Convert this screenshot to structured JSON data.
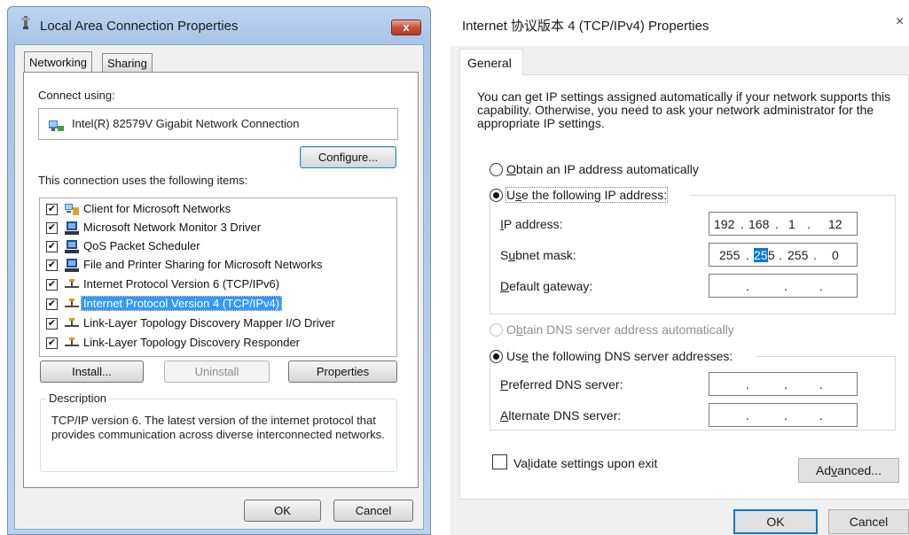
{
  "left_dialog": {
    "title": "Local Area Connection Properties",
    "close_label": "x",
    "tabs": [
      {
        "label": "Networking",
        "active": true
      },
      {
        "label": "Sharing",
        "active": false
      }
    ],
    "connect_using_label": "Connect using:",
    "adapter_name": "Intel(R) 82579V Gigabit Network Connection",
    "configure_label": "Configure...",
    "items_label": "This connection uses the following items:",
    "items": [
      {
        "label": "Client for Microsoft Networks",
        "checked": true,
        "icon": "network-client-icon"
      },
      {
        "label": "Microsoft Network Monitor 3 Driver",
        "checked": true,
        "icon": "network-service-icon"
      },
      {
        "label": "QoS Packet Scheduler",
        "checked": true,
        "icon": "network-service-icon"
      },
      {
        "label": "File and Printer Sharing for Microsoft Networks",
        "checked": true,
        "icon": "network-service-icon"
      },
      {
        "label": "Internet Protocol Version 6 (TCP/IPv6)",
        "checked": true,
        "icon": "protocol-icon"
      },
      {
        "label": "Internet Protocol Version 4 (TCP/IPv4)",
        "checked": true,
        "icon": "protocol-icon",
        "selected": true
      },
      {
        "label": "Link-Layer Topology Discovery Mapper I/O Driver",
        "checked": true,
        "icon": "protocol-icon"
      },
      {
        "label": "Link-Layer Topology Discovery Responder",
        "checked": true,
        "icon": "protocol-icon"
      }
    ],
    "install_label": "Install...",
    "uninstall_label": "Uninstall",
    "properties_label": "Properties",
    "description_legend": "Description",
    "description_text": "TCP/IP version 6. The latest version of the internet protocol that provides communication across diverse interconnected networks.",
    "ok_label": "OK",
    "cancel_label": "Cancel"
  },
  "right_dialog": {
    "title": "Internet 协议版本 4 (TCP/IPv4) Properties",
    "close_label": "×",
    "tab_label": "General",
    "intro_text": "You can get IP settings assigned automatically if your network supports this capability. Otherwise, you need to ask your network administrator for the appropriate IP settings.",
    "ip_auto": {
      "pre": "",
      "key": "O",
      "post": "btain an IP address automatically",
      "selected": false
    },
    "ip_manual": {
      "pre": "U",
      "key": "s",
      "post": "e the following IP address:",
      "selected": true
    },
    "ip_address": {
      "label_key": "I",
      "label_post": "P address:",
      "octets": [
        "192",
        "168",
        "1",
        "12"
      ]
    },
    "subnet_mask": {
      "label_pre": "S",
      "label_key": "u",
      "label_post": "bnet mask:",
      "octets": [
        "255",
        "255",
        "255",
        "0"
      ],
      "highlight": "25"
    },
    "default_gateway": {
      "label_key": "D",
      "label_post": "efault gateway:",
      "octets": [
        "",
        "",
        "",
        ""
      ]
    },
    "dns_auto": {
      "pre": "O",
      "key": "b",
      "post": "tain DNS server address automatically",
      "selected": false,
      "disabled": true
    },
    "dns_manual": {
      "pre": "Us",
      "key": "e",
      "post": " the following DNS server addresses:",
      "selected": true
    },
    "preferred_dns": {
      "label_key": "P",
      "label_post": "referred DNS server:",
      "octets": [
        "",
        "",
        "",
        ""
      ]
    },
    "alternate_dns": {
      "label_key": "A",
      "label_post": "lternate DNS server:",
      "octets": [
        "",
        "",
        "",
        ""
      ]
    },
    "validate": {
      "pre": "Va",
      "key": "l",
      "post": "idate settings upon exit",
      "checked": false
    },
    "advanced": {
      "pre": "Ad",
      "key": "v",
      "post": "anced..."
    },
    "ok_label": "OK",
    "cancel_label": "Cancel",
    "accent_color": "#0078d7"
  }
}
